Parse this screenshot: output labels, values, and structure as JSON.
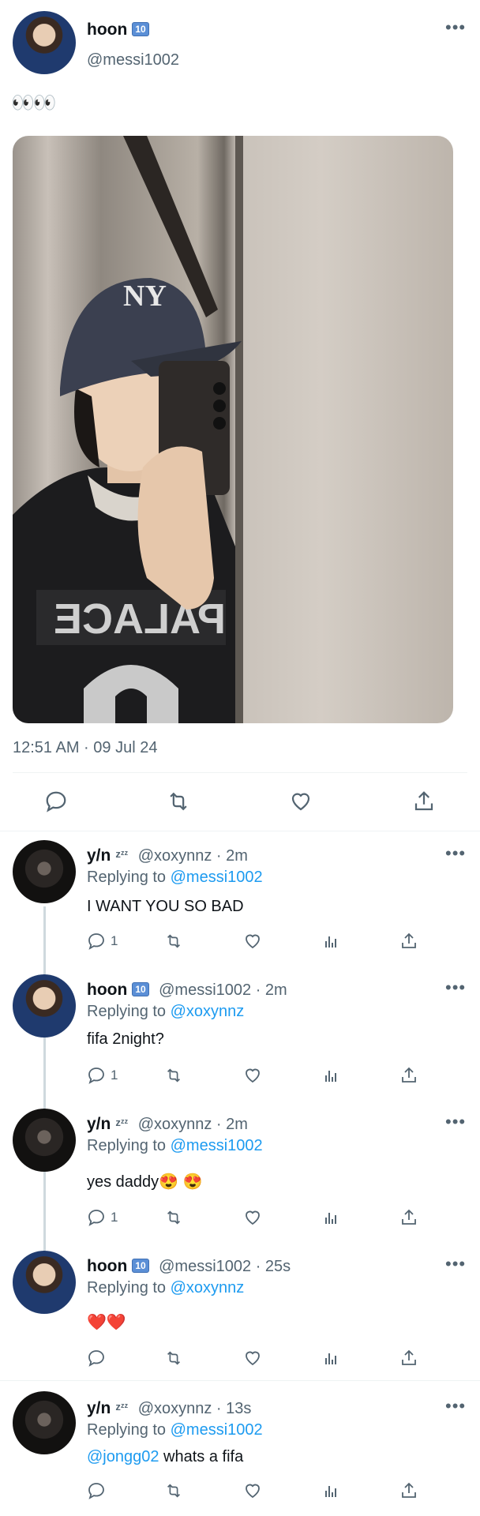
{
  "main_tweet": {
    "name": "hoon",
    "badge": "10",
    "handle": "@messi1002",
    "text": "👀👀",
    "timestamp": "12:51 AM · 09 Jul 24"
  },
  "replies": [
    {
      "name": "y/n",
      "zzz": "zᶻᶻ",
      "handle_meta": "@xoxynnz · 2m",
      "replying_prefix": "Replying to ",
      "replying_to": "@messi1002",
      "text": "I WANT YOU SO BAD",
      "reply_count": "1"
    },
    {
      "name": "hoon",
      "badge": "10",
      "handle_meta": "@messi1002 · 2m",
      "replying_prefix": "Replying to ",
      "replying_to": "@xoxynnz",
      "text": "fifa 2night?",
      "reply_count": "1"
    },
    {
      "name": "y/n",
      "zzz": "zᶻᶻ",
      "handle_meta": "@xoxynnz · 2m",
      "replying_prefix": "Replying to ",
      "replying_to": "@messi1002",
      "text": "yes daddy😍 😍",
      "reply_count": "1"
    },
    {
      "name": "hoon",
      "badge": "10",
      "handle_meta": "@messi1002 · 25s",
      "replying_prefix": "Replying to ",
      "replying_to": "@xoxynnz",
      "text": "❤️❤️",
      "reply_count": ""
    },
    {
      "name": "y/n",
      "zzz": "zᶻᶻ",
      "handle_meta": "@xoxynnz · 13s",
      "replying_prefix": "Replying to ",
      "replying_to": "@messi1002",
      "mention": "@jongg02",
      "text": " whats a fifa",
      "reply_count": ""
    }
  ],
  "colors": {
    "link": "#1d9bf0",
    "secondary": "#536471",
    "badge": "#5b8fd6"
  }
}
